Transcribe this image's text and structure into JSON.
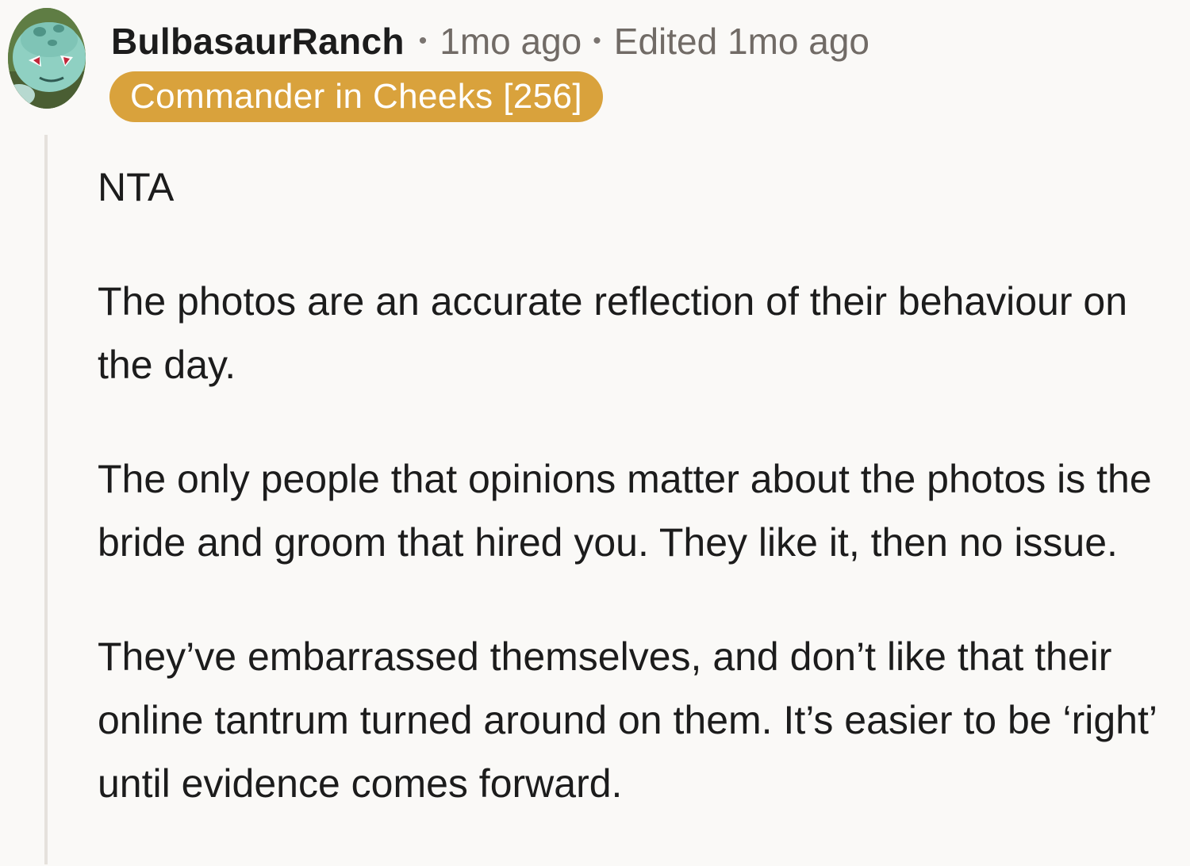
{
  "comment": {
    "username": "BulbasaurRanch",
    "posted": "1mo ago",
    "edited": "Edited 1mo ago",
    "separator": "•",
    "flair": "Commander in Cheeks [256]",
    "paragraphs": [
      "NTA",
      "The photos are an accurate reflection of their behaviour on the day.",
      "The only people that opinions matter about the photos is the bride and groom that hired you. They like it, then no issue.",
      "They’ve embarrassed themselves, and don’t like that their online tantrum turned around on them. It’s easier to be ‘right’ until evidence comes forward."
    ]
  },
  "colors": {
    "background": "#faf9f7",
    "flair": "#d9a23c",
    "meta_text": "#716b66",
    "thread_line": "#e5e1dc"
  },
  "icons": {
    "avatar": "bulbasaur-avatar"
  }
}
